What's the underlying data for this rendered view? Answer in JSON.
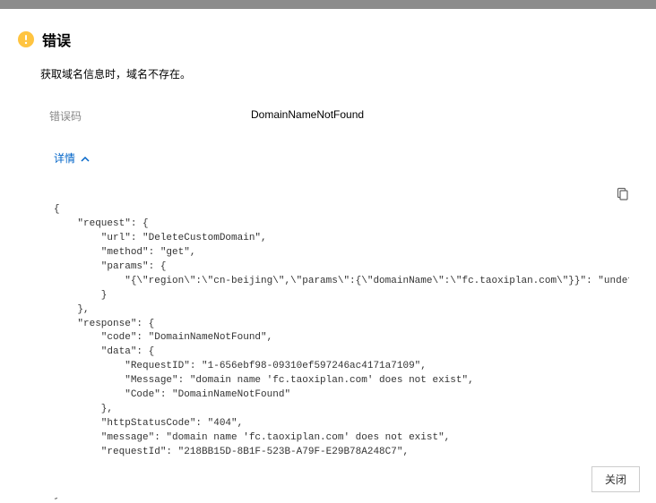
{
  "dialog": {
    "title": "错误",
    "message": "获取域名信息时，域名不存在。",
    "error_code_label": "错误码",
    "error_code_value": "DomainNameNotFound",
    "details_label": "详情",
    "close_label": "关闭"
  },
  "icons": {
    "warning": "warning-icon",
    "chevron_up": "chevron-up-icon",
    "copy": "copy-icon"
  },
  "colors": {
    "link": "#0064c8",
    "warn_bg": "#ffc440",
    "warn_fg": "#ffffff"
  },
  "details_json": {
    "request": {
      "url": "DeleteCustomDomain",
      "method": "get",
      "params": {
        "{\"region\":\"cn-beijing\",\"params\":{\"domainName\":\"fc.taoxiplan.com\"}}": "undefined"
      }
    },
    "response": {
      "code": "DomainNameNotFound",
      "data": {
        "RequestID": "1-656ebf98-09310ef597246ac4171a7109",
        "Message": "domain name 'fc.taoxiplan.com' does not exist",
        "Code": "DomainNameNotFound"
      },
      "httpStatusCode": "404",
      "message": "domain name 'fc.taoxiplan.com' does not exist",
      "requestId": "218BB15D-8B1F-523B-A79F-E29B78A248C7",
      "successResponse": false
    }
  }
}
